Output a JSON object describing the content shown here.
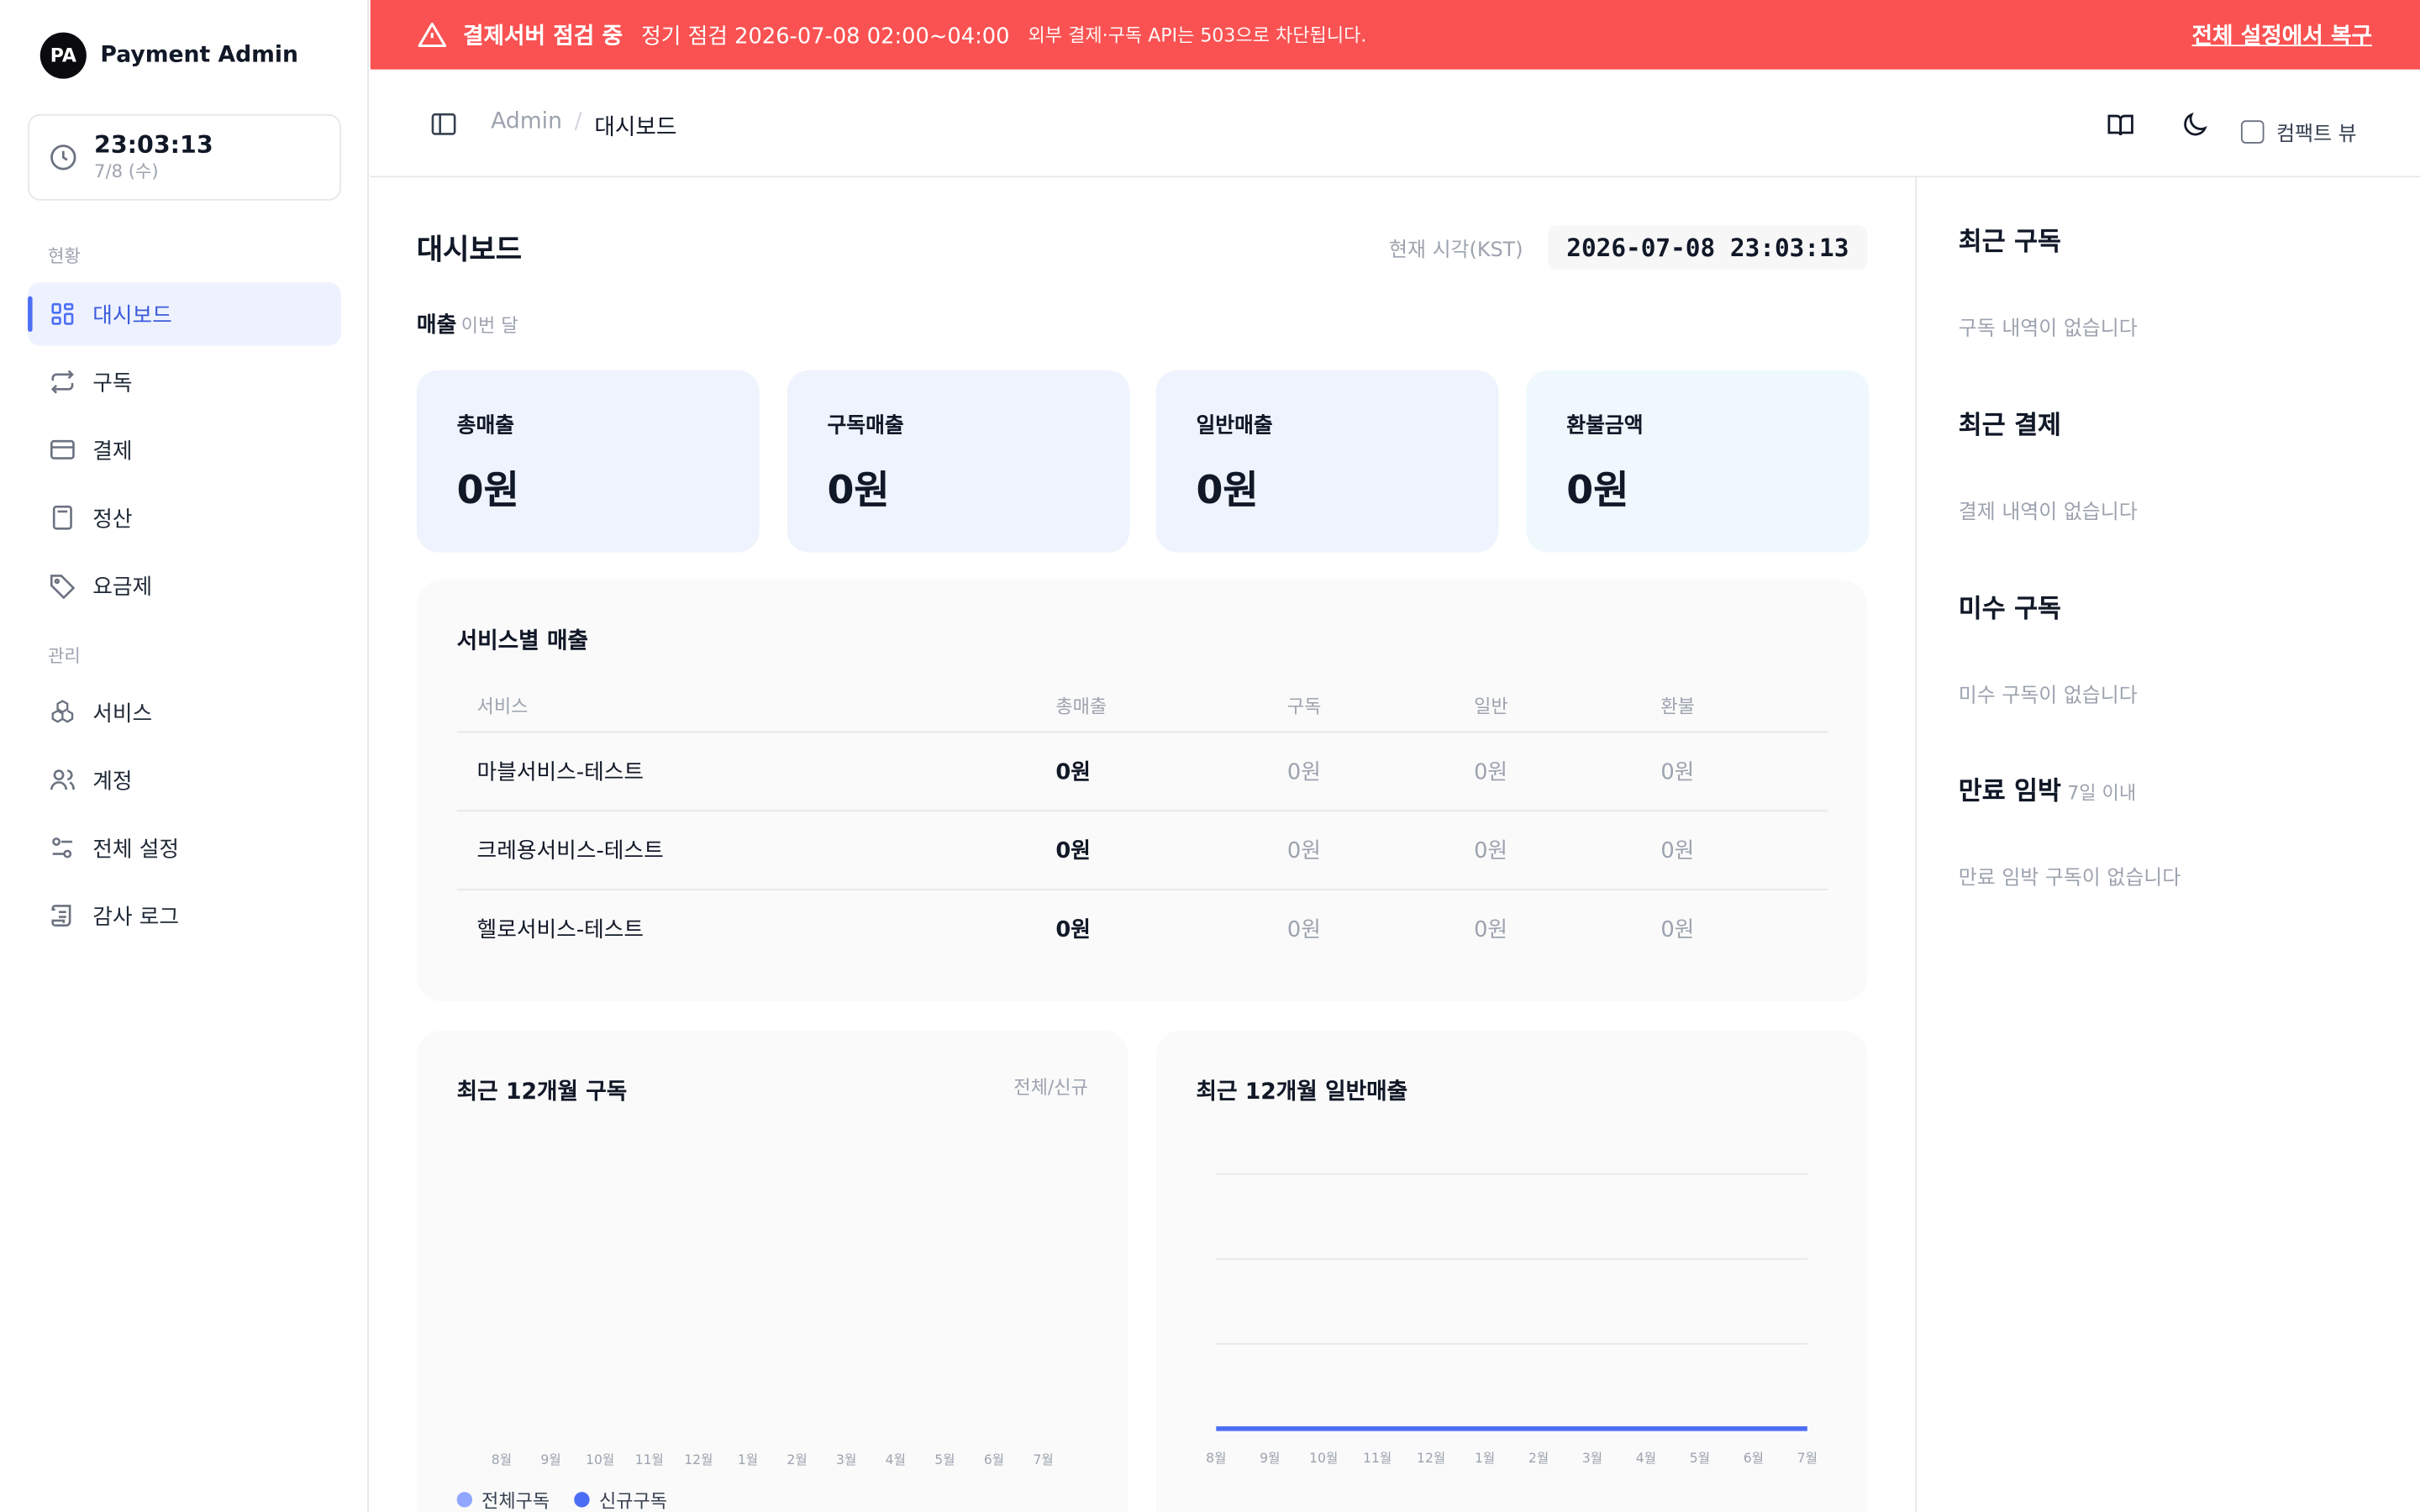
{
  "app": {
    "logo": "PA",
    "name": "Payment Admin"
  },
  "clock": {
    "time": "23:03:13",
    "date": "7/8 (수)"
  },
  "sidebar": {
    "sections": [
      "현황",
      "관리"
    ],
    "items": [
      {
        "label": "대시보드",
        "icon": "dashboard-icon"
      },
      {
        "label": "구독",
        "icon": "repeat-icon"
      },
      {
        "label": "결제",
        "icon": "credit-card-icon"
      },
      {
        "label": "정산",
        "icon": "calculator-icon"
      },
      {
        "label": "요금제",
        "icon": "tag-icon"
      },
      {
        "label": "서비스",
        "icon": "boxes-icon"
      },
      {
        "label": "계정",
        "icon": "users-icon"
      },
      {
        "label": "전체 설정",
        "icon": "sliders-icon"
      },
      {
        "label": "감사 로그",
        "icon": "scroll-icon"
      }
    ]
  },
  "banner": {
    "title": "결제서버 점검 중",
    "time": "정기 점검 2026-07-08 02:00~04:00",
    "desc": "외부 결제·구독 API는 503으로 차단됩니다.",
    "link": "전체 설정에서 복구",
    "color": "#fa5252"
  },
  "header": {
    "crumb_root": "Admin",
    "crumb_sep": "/",
    "crumb_current": "대시보드",
    "compact_label": "컴팩트 뷰"
  },
  "main": {
    "title": "대시보드",
    "now_label": "현재 시각(KST)",
    "now_value": "2026-07-08 23:03:13",
    "revenue_label": "매출",
    "revenue_period": "이번 달",
    "kpis": [
      {
        "label": "총매출",
        "value": "0원"
      },
      {
        "label": "구독매출",
        "value": "0원"
      },
      {
        "label": "일반매출",
        "value": "0원"
      },
      {
        "label": "환불금액",
        "value": "0원"
      }
    ],
    "service_table": {
      "title": "서비스별 매출",
      "headers": [
        "서비스",
        "총매출",
        "구독",
        "일반",
        "환불"
      ],
      "rows": [
        [
          "마블서비스-테스트",
          "0원",
          "0원",
          "0원",
          "0원"
        ],
        [
          "크레용서비스-테스트",
          "0원",
          "0원",
          "0원",
          "0원"
        ],
        [
          "헬로서비스-테스트",
          "0원",
          "0원",
          "0원",
          "0원"
        ]
      ]
    }
  },
  "chart_data": [
    {
      "type": "bar",
      "title": "최근 12개월 구독",
      "subtitle": "전체/신규",
      "categories": [
        "8월",
        "9월",
        "10월",
        "11월",
        "12월",
        "1월",
        "2월",
        "3월",
        "4월",
        "5월",
        "6월",
        "7월"
      ],
      "series": [
        {
          "name": "전체구독",
          "values": [
            0,
            0,
            0,
            0,
            0,
            0,
            0,
            0,
            0,
            0,
            0,
            0
          ],
          "color": "#91a7ff"
        },
        {
          "name": "신규구독",
          "values": [
            0,
            0,
            0,
            0,
            0,
            0,
            0,
            0,
            0,
            0,
            0,
            0
          ],
          "color": "#4c6ef5"
        }
      ],
      "legend": "bottom-left"
    },
    {
      "type": "line",
      "title": "최근 12개월 일반매출",
      "categories": [
        "8월",
        "9월",
        "10월",
        "11월",
        "12월",
        "1월",
        "2월",
        "3월",
        "4월",
        "5월",
        "6월",
        "7월"
      ],
      "series": [
        {
          "values": [
            0,
            0,
            0,
            0,
            0,
            0,
            0,
            0,
            0,
            0,
            0,
            0
          ],
          "color": "#4c6ef5"
        }
      ],
      "grid": true
    }
  ],
  "right": {
    "sections": [
      {
        "title": "최근 구독",
        "empty": "구독 내역이 없습니다"
      },
      {
        "title": "최근 결제",
        "empty": "결제 내역이 없습니다"
      },
      {
        "title": "미수 구독",
        "empty": "미수 구독이 없습니다"
      },
      {
        "title": "만료 임박",
        "note": "7일 이내",
        "empty": "만료 임박 구독이 없습니다"
      }
    ]
  }
}
